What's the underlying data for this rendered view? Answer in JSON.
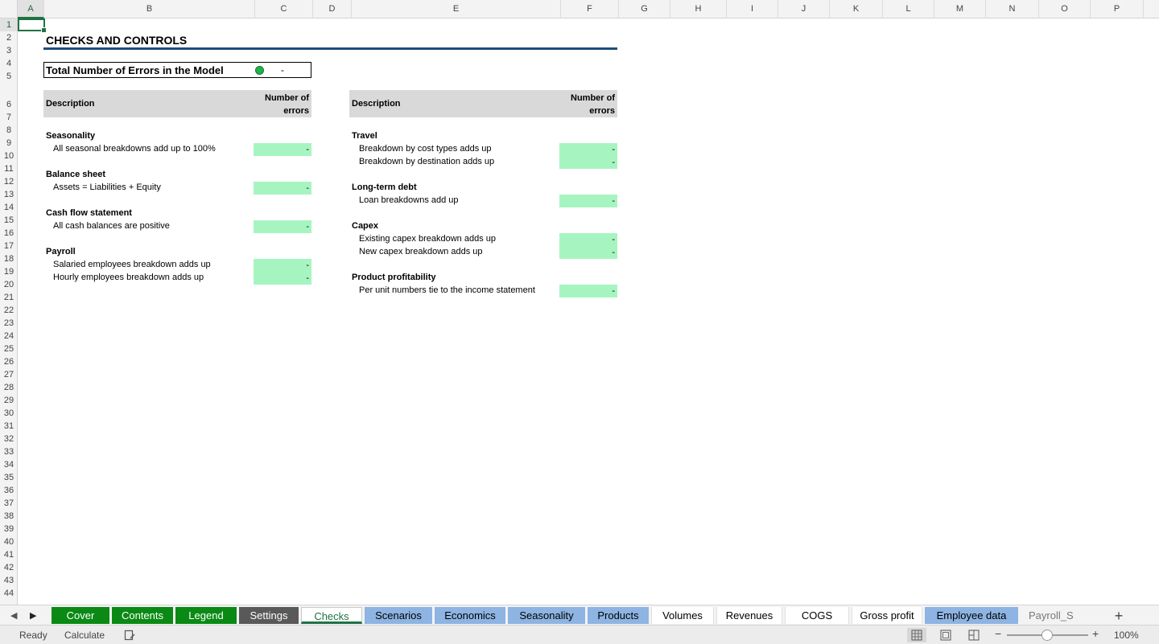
{
  "columns": [
    "A",
    "B",
    "C",
    "D",
    "E",
    "F",
    "G",
    "H",
    "I",
    "J",
    "K",
    "L",
    "M",
    "N",
    "O",
    "P"
  ],
  "rows": [
    "1",
    "2",
    "3",
    "4",
    "5",
    "6",
    "7",
    "8",
    "9",
    "10",
    "11",
    "12",
    "13",
    "14",
    "15",
    "16",
    "17",
    "18",
    "19",
    "20",
    "21",
    "22",
    "23",
    "24",
    "25",
    "26",
    "27",
    "28",
    "29",
    "30",
    "31",
    "32",
    "33",
    "34",
    "35",
    "36",
    "37",
    "38",
    "39",
    "40",
    "41",
    "42",
    "43",
    "44"
  ],
  "sheet": {
    "title": "CHECKS AND CONTROLS",
    "total_label": "Total Number of Errors in the Model",
    "total_value": "-",
    "status_color": "#21b24b",
    "left_table": {
      "head_desc": "Description",
      "head_num_1": "Number of",
      "head_num_2": "errors",
      "groups": [
        {
          "title": "Seasonality",
          "items": [
            {
              "label": "All seasonal breakdowns add up to 100%",
              "value": "-"
            }
          ]
        },
        {
          "title": "Balance sheet",
          "items": [
            {
              "label": "Assets = Liabilities + Equity",
              "value": "-"
            }
          ]
        },
        {
          "title": "Cash flow statement",
          "items": [
            {
              "label": "All cash balances are positive",
              "value": "-"
            }
          ]
        },
        {
          "title": "Payroll",
          "items": [
            {
              "label": "Salaried employees breakdown adds up",
              "value": "-"
            },
            {
              "label": "Hourly employees breakdown adds up",
              "value": "-"
            }
          ]
        }
      ]
    },
    "right_table": {
      "head_desc": "Description",
      "head_num_1": "Number of",
      "head_num_2": "errors",
      "groups": [
        {
          "title": "Travel",
          "items": [
            {
              "label": "Breakdown by cost types adds up",
              "value": "-"
            },
            {
              "label": "Breakdown by destination adds up",
              "value": "-"
            }
          ]
        },
        {
          "title": "Long-term debt",
          "items": [
            {
              "label": "Loan breakdowns add up",
              "value": "-"
            }
          ]
        },
        {
          "title": "Capex",
          "items": [
            {
              "label": "Existing capex breakdown adds up",
              "value": "-"
            },
            {
              "label": "New capex breakdown adds up",
              "value": "-"
            }
          ]
        },
        {
          "title": "Product profitability",
          "items": [
            {
              "label": "Per unit numbers tie to the income statement",
              "value": "-"
            }
          ]
        }
      ]
    }
  },
  "tabs": [
    {
      "label": "Cover",
      "style": "green"
    },
    {
      "label": "Contents",
      "style": "green"
    },
    {
      "label": "Legend",
      "style": "green"
    },
    {
      "label": "Settings",
      "style": "gray"
    },
    {
      "label": "Checks",
      "style": "active"
    },
    {
      "label": "Scenarios",
      "style": "blue"
    },
    {
      "label": "Economics",
      "style": "blue"
    },
    {
      "label": "Seasonality",
      "style": "blue"
    },
    {
      "label": "Products",
      "style": "blue"
    },
    {
      "label": "Volumes",
      "style": "white"
    },
    {
      "label": "Revenues",
      "style": "white"
    },
    {
      "label": "COGS",
      "style": "white"
    },
    {
      "label": "Gross profit",
      "style": "white"
    },
    {
      "label": "Employee data",
      "style": "blue"
    },
    {
      "label": "Payroll_S",
      "style": "faded"
    }
  ],
  "tab_colors": {
    "green": "#0a8a14",
    "gray": "#595959",
    "blue": "#8db4e2",
    "accent": "#1f7244"
  },
  "status": {
    "ready": "Ready",
    "calculate": "Calculate",
    "zoom": "100%",
    "icons": [
      "macro-record-icon",
      "normal-view-icon",
      "page-layout-view-icon",
      "page-break-view-icon"
    ],
    "zoom_minus": "−",
    "zoom_plus": "+"
  },
  "add_sheet": "+",
  "nav": {
    "prev": "◀",
    "next": "▶"
  }
}
